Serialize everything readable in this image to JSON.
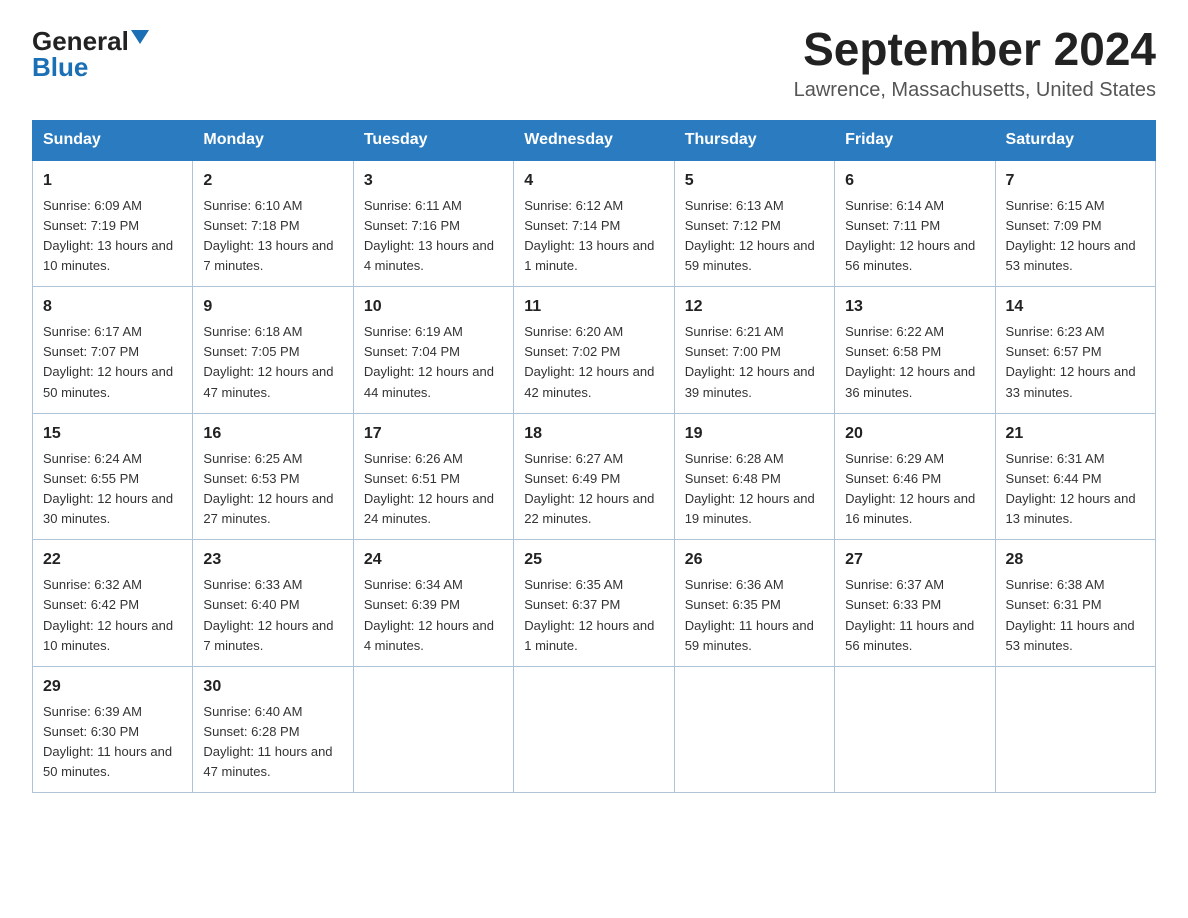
{
  "logo": {
    "general": "General",
    "blue": "Blue"
  },
  "title": "September 2024",
  "subtitle": "Lawrence, Massachusetts, United States",
  "weekdays": [
    "Sunday",
    "Monday",
    "Tuesday",
    "Wednesday",
    "Thursday",
    "Friday",
    "Saturday"
  ],
  "weeks": [
    [
      {
        "day": "1",
        "sunrise": "6:09 AM",
        "sunset": "7:19 PM",
        "daylight": "13 hours and 10 minutes."
      },
      {
        "day": "2",
        "sunrise": "6:10 AM",
        "sunset": "7:18 PM",
        "daylight": "13 hours and 7 minutes."
      },
      {
        "day": "3",
        "sunrise": "6:11 AM",
        "sunset": "7:16 PM",
        "daylight": "13 hours and 4 minutes."
      },
      {
        "day": "4",
        "sunrise": "6:12 AM",
        "sunset": "7:14 PM",
        "daylight": "13 hours and 1 minute."
      },
      {
        "day": "5",
        "sunrise": "6:13 AM",
        "sunset": "7:12 PM",
        "daylight": "12 hours and 59 minutes."
      },
      {
        "day": "6",
        "sunrise": "6:14 AM",
        "sunset": "7:11 PM",
        "daylight": "12 hours and 56 minutes."
      },
      {
        "day": "7",
        "sunrise": "6:15 AM",
        "sunset": "7:09 PM",
        "daylight": "12 hours and 53 minutes."
      }
    ],
    [
      {
        "day": "8",
        "sunrise": "6:17 AM",
        "sunset": "7:07 PM",
        "daylight": "12 hours and 50 minutes."
      },
      {
        "day": "9",
        "sunrise": "6:18 AM",
        "sunset": "7:05 PM",
        "daylight": "12 hours and 47 minutes."
      },
      {
        "day": "10",
        "sunrise": "6:19 AM",
        "sunset": "7:04 PM",
        "daylight": "12 hours and 44 minutes."
      },
      {
        "day": "11",
        "sunrise": "6:20 AM",
        "sunset": "7:02 PM",
        "daylight": "12 hours and 42 minutes."
      },
      {
        "day": "12",
        "sunrise": "6:21 AM",
        "sunset": "7:00 PM",
        "daylight": "12 hours and 39 minutes."
      },
      {
        "day": "13",
        "sunrise": "6:22 AM",
        "sunset": "6:58 PM",
        "daylight": "12 hours and 36 minutes."
      },
      {
        "day": "14",
        "sunrise": "6:23 AM",
        "sunset": "6:57 PM",
        "daylight": "12 hours and 33 minutes."
      }
    ],
    [
      {
        "day": "15",
        "sunrise": "6:24 AM",
        "sunset": "6:55 PM",
        "daylight": "12 hours and 30 minutes."
      },
      {
        "day": "16",
        "sunrise": "6:25 AM",
        "sunset": "6:53 PM",
        "daylight": "12 hours and 27 minutes."
      },
      {
        "day": "17",
        "sunrise": "6:26 AM",
        "sunset": "6:51 PM",
        "daylight": "12 hours and 24 minutes."
      },
      {
        "day": "18",
        "sunrise": "6:27 AM",
        "sunset": "6:49 PM",
        "daylight": "12 hours and 22 minutes."
      },
      {
        "day": "19",
        "sunrise": "6:28 AM",
        "sunset": "6:48 PM",
        "daylight": "12 hours and 19 minutes."
      },
      {
        "day": "20",
        "sunrise": "6:29 AM",
        "sunset": "6:46 PM",
        "daylight": "12 hours and 16 minutes."
      },
      {
        "day": "21",
        "sunrise": "6:31 AM",
        "sunset": "6:44 PM",
        "daylight": "12 hours and 13 minutes."
      }
    ],
    [
      {
        "day": "22",
        "sunrise": "6:32 AM",
        "sunset": "6:42 PM",
        "daylight": "12 hours and 10 minutes."
      },
      {
        "day": "23",
        "sunrise": "6:33 AM",
        "sunset": "6:40 PM",
        "daylight": "12 hours and 7 minutes."
      },
      {
        "day": "24",
        "sunrise": "6:34 AM",
        "sunset": "6:39 PM",
        "daylight": "12 hours and 4 minutes."
      },
      {
        "day": "25",
        "sunrise": "6:35 AM",
        "sunset": "6:37 PM",
        "daylight": "12 hours and 1 minute."
      },
      {
        "day": "26",
        "sunrise": "6:36 AM",
        "sunset": "6:35 PM",
        "daylight": "11 hours and 59 minutes."
      },
      {
        "day": "27",
        "sunrise": "6:37 AM",
        "sunset": "6:33 PM",
        "daylight": "11 hours and 56 minutes."
      },
      {
        "day": "28",
        "sunrise": "6:38 AM",
        "sunset": "6:31 PM",
        "daylight": "11 hours and 53 minutes."
      }
    ],
    [
      {
        "day": "29",
        "sunrise": "6:39 AM",
        "sunset": "6:30 PM",
        "daylight": "11 hours and 50 minutes."
      },
      {
        "day": "30",
        "sunrise": "6:40 AM",
        "sunset": "6:28 PM",
        "daylight": "11 hours and 47 minutes."
      },
      null,
      null,
      null,
      null,
      null
    ]
  ]
}
